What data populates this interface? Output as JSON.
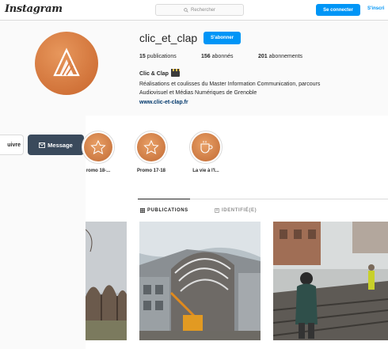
{
  "topbar": {
    "logo": "Instagram",
    "search_placeholder": "Rechercher",
    "login_label": "Se connecter",
    "signup_label": "S'inscri"
  },
  "profile": {
    "username": "clic_et_clap",
    "follow_label": "S'abonner",
    "stats": {
      "publications_count": "15",
      "publications_label": "publications",
      "followers_count": "156",
      "followers_label": "abonnés",
      "following_count": "201",
      "following_label": "abonnements"
    },
    "full_name": "Clic & Clap",
    "bio_line1": "Réalisations et coulisses du Master Information Communication, parcours",
    "bio_line2": "Audiovisuel et Médias Numériques de Grenoble",
    "website": "www.clic-et-clap.fr"
  },
  "actions": {
    "follow_partial": "uivre",
    "message_label": "Message"
  },
  "highlights": [
    {
      "label": "romo 18-..."
    },
    {
      "label": "Promo 17-18"
    },
    {
      "label": "La vie à l'I..."
    }
  ],
  "tabs": {
    "publications": "PUBLICATIONS",
    "tagged": "IDENTIFIÉ(E)"
  },
  "colors": {
    "brand_blue": "#0095f6",
    "avatar_orange": "#d9773c",
    "message_button": "#3a4a5c"
  },
  "icons": {
    "search": "search-icon",
    "mail": "envelope-icon",
    "grid": "grid-icon",
    "tag": "tag-icon"
  }
}
